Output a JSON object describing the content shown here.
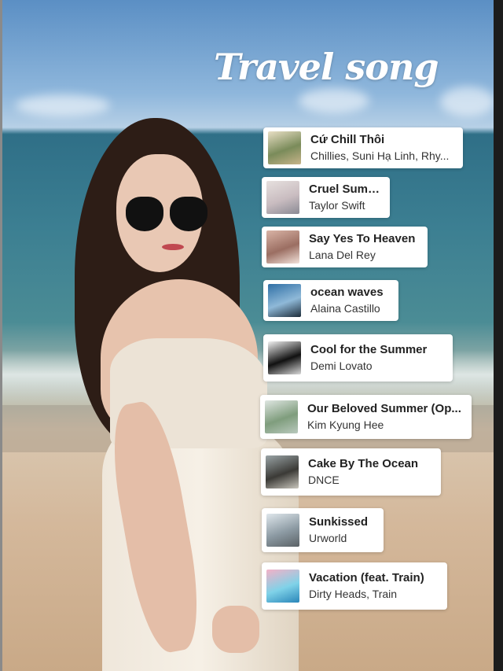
{
  "title": "Travel song",
  "songs": [
    {
      "title": "Cứ Chill Thôi",
      "artist": "Chillies, Suni Hạ Linh, Rhy...",
      "thumb_icon": "album-art-cu-chill-thoi",
      "colors": [
        "#e9dfc5",
        "#7a8b5a",
        "#c7b48a"
      ]
    },
    {
      "title": "Cruel Summer",
      "artist": "Taylor Swift",
      "thumb_icon": "album-art-cruel-summer",
      "colors": [
        "#e6e0de",
        "#c9bcc0",
        "#8a8a94"
      ]
    },
    {
      "title": "Say Yes To Heaven",
      "artist": "Lana Del Rey",
      "thumb_icon": "album-art-say-yes-to-heaven",
      "colors": [
        "#d9b4a6",
        "#9b6e62",
        "#f2e2da"
      ]
    },
    {
      "title": "ocean waves",
      "artist": "Alaina Castillo",
      "thumb_icon": "album-art-ocean-waves",
      "colors": [
        "#2f6fa5",
        "#8fb9d8",
        "#1d2c3a"
      ]
    },
    {
      "title": "Cool for the Summer",
      "artist": "Demi Lovato",
      "thumb_icon": "album-art-cool-for-the-summer",
      "colors": [
        "#f2f2f2",
        "#111111",
        "#d9d9d9"
      ]
    },
    {
      "title": "Our Beloved Summer (Op...",
      "artist": "Kim Kyung Hee",
      "thumb_icon": "album-art-our-beloved-summer",
      "colors": [
        "#dfe6e2",
        "#7f9d7d",
        "#b9c9bd"
      ]
    },
    {
      "title": "Cake By The Ocean",
      "artist": "DNCE",
      "thumb_icon": "album-art-cake-by-the-ocean",
      "colors": [
        "#9aa4a6",
        "#3b3a36",
        "#c9c6bd"
      ]
    },
    {
      "title": "Sunkissed",
      "artist": "Urworld",
      "thumb_icon": "album-art-sunkissed",
      "colors": [
        "#dfe7ec",
        "#8c9aa3",
        "#5b6266"
      ]
    },
    {
      "title": "Vacation (feat. Train)",
      "artist": "Dirty Heads, Train",
      "thumb_icon": "album-art-vacation",
      "colors": [
        "#f4b1c7",
        "#7fd2e8",
        "#2a86b9"
      ]
    }
  ]
}
